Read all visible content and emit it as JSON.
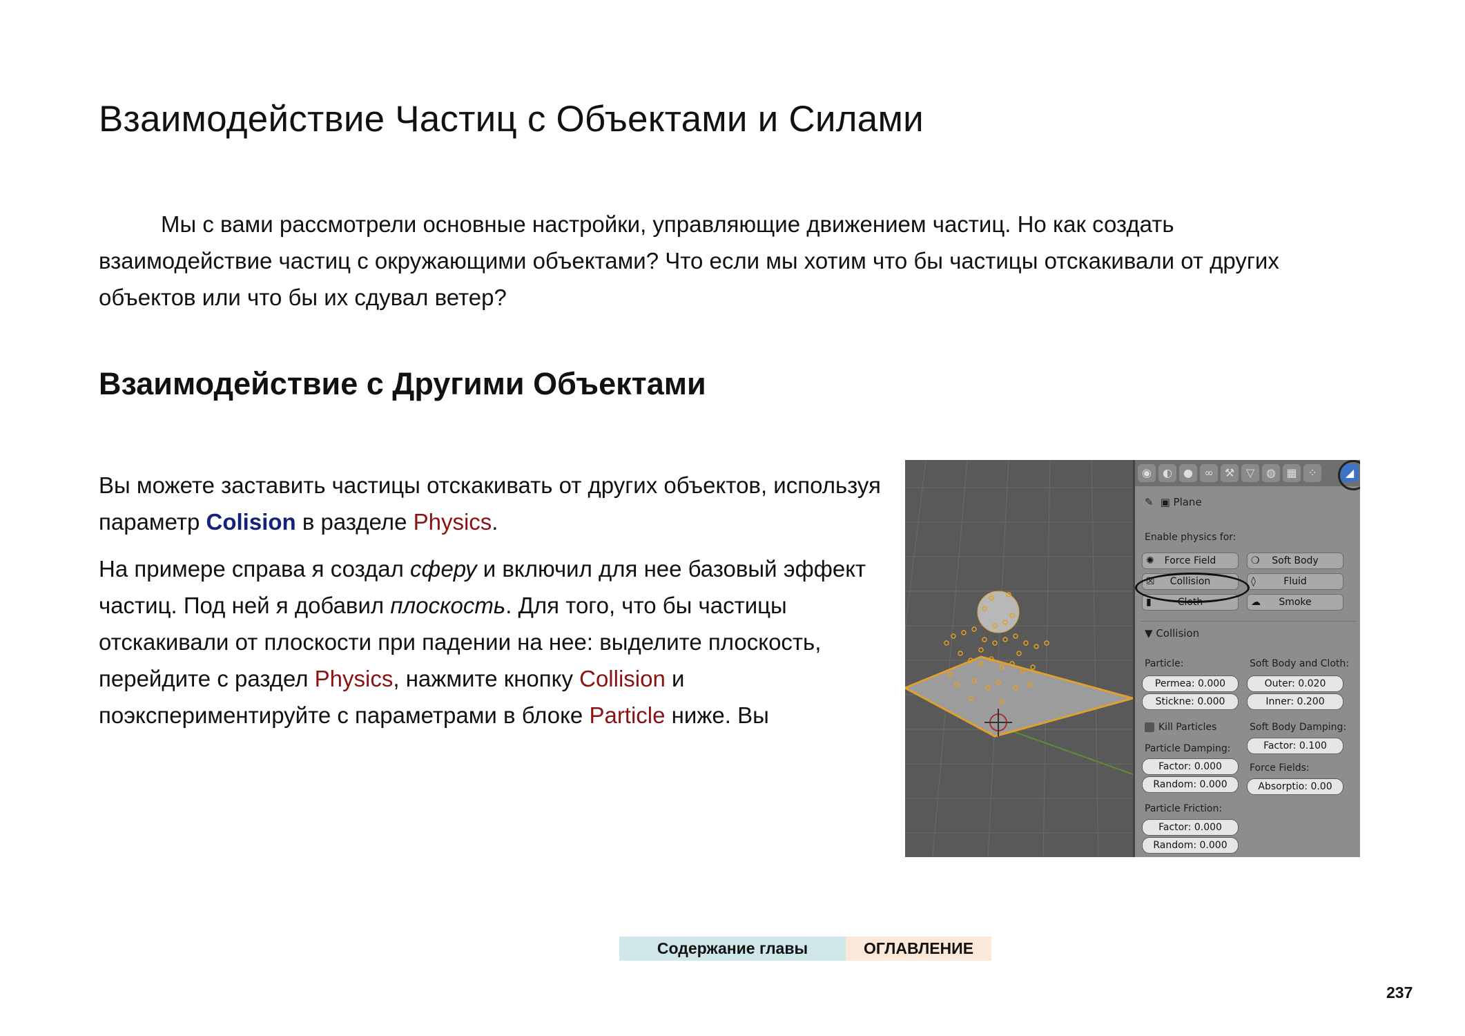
{
  "title": "Взаимодействие Частиц с Объектами и Силами",
  "intro": "Мы с вами рассмотрели основные настройки, управляющие движением частиц. Но как создать взаимодействие частиц с окружающими объектами? Что если мы хотим что бы частицы отскакивали от других объектов или что бы их сдувал ветер?",
  "subtitle": "Взаимодействие с Другими Объектами",
  "para1": {
    "t1": "Вы можете заставить частицы отскакивать от других объектов, используя параметр ",
    "kw1": "Colision",
    "t2": " в разделе ",
    "kw2": "Physics",
    "t3": "."
  },
  "para2": {
    "t1": "На примере справа я создал ",
    "em1": "сферу",
    "t2": " и включил для нее базовый эффект частиц. Под ней я добавил ",
    "em2": "плоскость",
    "t3": ". Для того, что бы частицы отскакивали от плоскости при падении на нее: выделите плоскость, перейдите с раздел ",
    "kw1": "Physics",
    "t4": ", нажмите кнопку ",
    "kw2": "Collision",
    "t5": " и поэкспериментируйте с параметрами в блоке ",
    "kw3": "Particle",
    "t6": " ниже. Вы"
  },
  "figure": {
    "object_name": "Plane",
    "enable_physics_label": "Enable physics for:",
    "buttons": {
      "force_field": "Force Field",
      "soft_body": "Soft Body",
      "collision": "Collision",
      "fluid": "Fluid",
      "cloth": "Cloth",
      "smoke": "Smoke"
    },
    "section_label": "Collision",
    "particle_label": "Particle:",
    "soft_body_cloth_label": "Soft Body and Cloth:",
    "permea": "Permea: 0.000",
    "stickne": "Stickne: 0.000",
    "outer": "Outer: 0.020",
    "inner": "Inner: 0.200",
    "kill_particles": "Kill Particles",
    "soft_body_damping_label": "Soft Body Damping:",
    "particle_damping_label": "Particle Damping:",
    "sbd_factor": "Factor: 0.100",
    "pd_factor": "Factor: 0.000",
    "pd_random": "Random: 0.000",
    "force_fields_label": "Force Fields:",
    "absorption": "Absorptio: 0.00",
    "particle_friction_label": "Particle Friction:",
    "pf_factor": "Factor: 0.000",
    "pf_random": "Random: 0.000"
  },
  "nav": {
    "chapter_contents": "Содержание главы",
    "toc": "ОГЛАВЛЕНИЕ"
  },
  "page_number": "237",
  "colors": {
    "keyword_blue": "#14237a",
    "keyword_red": "#8b1212",
    "nav_contents_bg": "#cfe7e9",
    "nav_toc_bg": "#fbe8d8",
    "active_tab": "#3d73c5"
  }
}
